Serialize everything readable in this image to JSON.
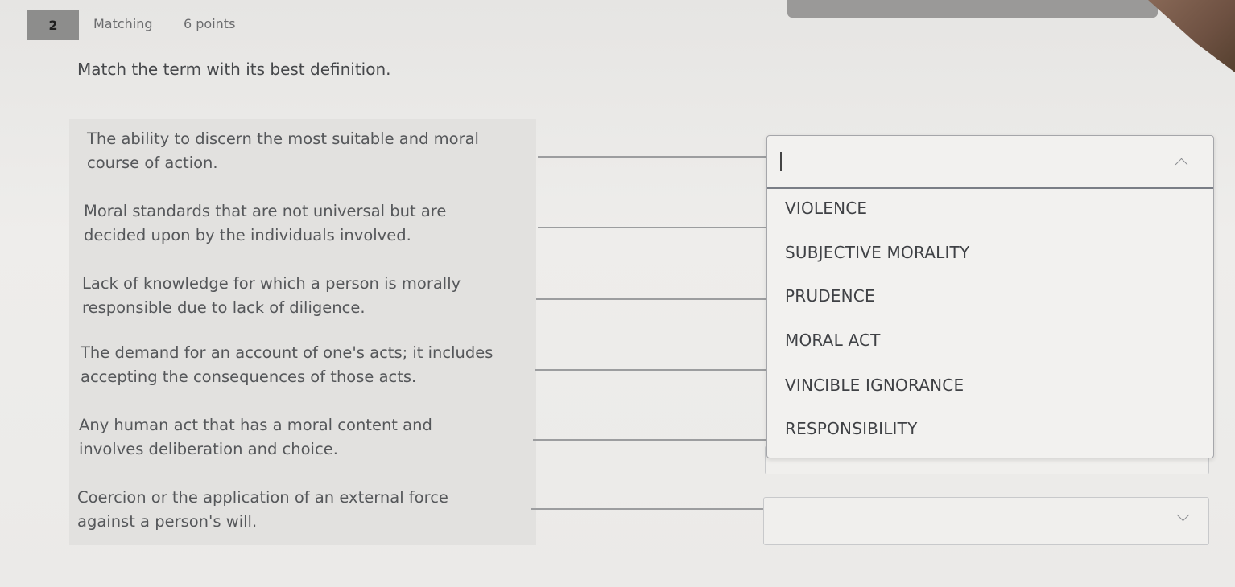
{
  "question": {
    "number": "2",
    "type": "Matching",
    "points": "6 points",
    "instruction": "Match the term with its best definition."
  },
  "terms": [
    {
      "line1": "The ability to discern the most suitable and moral",
      "line2": "course of action."
    },
    {
      "line1": "Moral standards that are not universal but are",
      "line2": "decided upon by the individuals involved."
    },
    {
      "line1": "Lack of knowledge for which a person is morally",
      "line2": "responsible due to lack of diligence."
    },
    {
      "line1": "The demand for an account of one's acts; it includes",
      "line2": "accepting the consequences of those acts."
    },
    {
      "line1": "Any human act that has a moral content and",
      "line2": "involves deliberation and choice."
    },
    {
      "line1": "Coercion or the application of an external force",
      "line2": "against a person's will."
    }
  ],
  "dropdown": {
    "value": "",
    "state": "open",
    "options": [
      "VIOLENCE",
      "SUBJECTIVE MORALITY",
      "PRUDENCE",
      "MORAL ACT",
      "VINCIBLE IGNORANCE",
      "RESPONSIBILITY"
    ]
  },
  "icons": {
    "open_dropdown": "chevron-up-icon",
    "closed_dropdown": "chevron-down-icon"
  }
}
